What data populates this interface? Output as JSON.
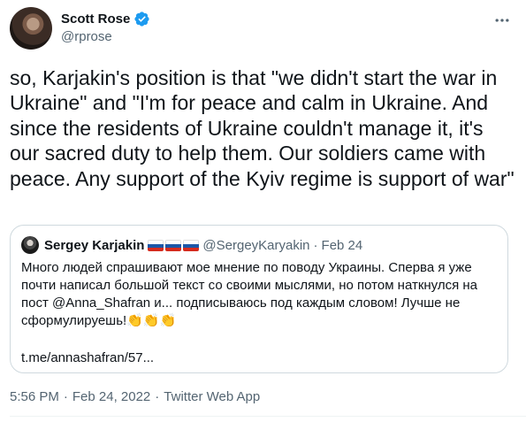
{
  "author": {
    "name": "Scott Rose",
    "handle": "@rprose"
  },
  "tweet": {
    "text": "so, Karjakin's position is that \"we didn't start the war in Ukraine\" and \"I'm for peace and calm in Ukraine. And since the residents of Ukraine couldn't manage it, it's our sacred duty to help them. Our soldiers came with peace. Any support of the Kyiv regime is support of war\""
  },
  "quote": {
    "name": "Sergey Karjakin",
    "handle": "@SergeyKaryakin",
    "separator": "·",
    "date": "Feb 24",
    "text": "Много людей спрашивают мое мнение по поводу Украины. Сперва я уже почти написал большой текст со своими мыслями, но потом наткнулся на пост @Anna_Shafran и... подписываюсь под каждым словом! Лучше не сформулируешь!",
    "emoji": "👏👏👏",
    "link": "t.me/annashafran/57..."
  },
  "meta": {
    "time": "5:56 PM",
    "separator1": "·",
    "date": "Feb 24, 2022",
    "separator2": "·",
    "source": "Twitter Web App"
  },
  "colors": {
    "verified": "#1d9bf0",
    "secondary_text": "#536471",
    "border": "#cfd9de"
  },
  "icons": [
    "verified-badge-icon",
    "more-options-icon",
    "russia-flag-icon"
  ]
}
